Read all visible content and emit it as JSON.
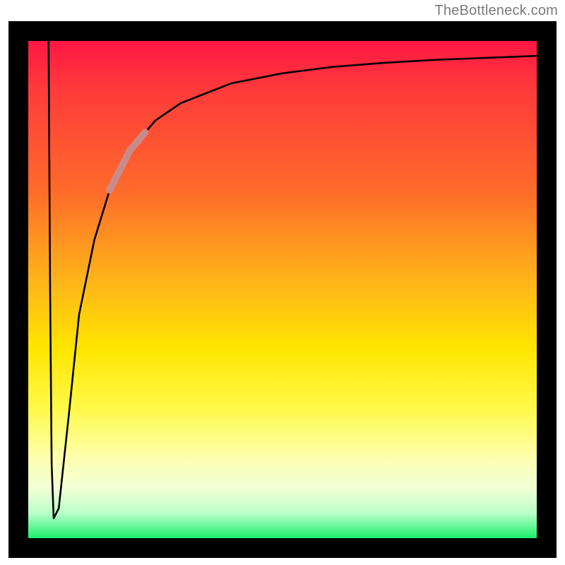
{
  "attribution": "TheBottleneck.com",
  "chart_data": {
    "type": "line",
    "title": "",
    "xlabel": "",
    "ylabel": "",
    "xlim": [
      0,
      100
    ],
    "ylim": [
      0,
      100
    ],
    "series": [
      {
        "name": "curve",
        "x": [
          4,
          4.3,
          4.6,
          5,
          6,
          8,
          10,
          13,
          16,
          20,
          25,
          30,
          40,
          50,
          60,
          70,
          80,
          90,
          100
        ],
        "y": [
          100,
          50,
          15,
          4,
          6,
          25,
          45,
          60,
          70,
          78,
          84,
          87.5,
          91.5,
          93.5,
          94.8,
          95.6,
          96.2,
          96.6,
          97
        ]
      }
    ],
    "highlight_segment": {
      "x_start": 16,
      "x_end": 23,
      "color": "#c98a8a"
    },
    "gradient_stops": [
      {
        "pos": 0,
        "color": "#ff1744"
      },
      {
        "pos": 10,
        "color": "#ff3b3b"
      },
      {
        "pos": 30,
        "color": "#ff6a2a"
      },
      {
        "pos": 48,
        "color": "#ffb31a"
      },
      {
        "pos": 62,
        "color": "#ffe600"
      },
      {
        "pos": 74,
        "color": "#fff94a"
      },
      {
        "pos": 84,
        "color": "#fdffb0"
      },
      {
        "pos": 90,
        "color": "#f2ffd6"
      },
      {
        "pos": 95,
        "color": "#b8ffc8"
      },
      {
        "pos": 100,
        "color": "#1bef6a"
      }
    ]
  }
}
